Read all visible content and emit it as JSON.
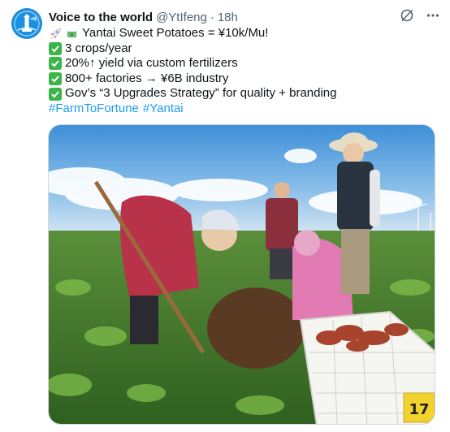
{
  "author": {
    "name": "Voice to the world",
    "handle": "@YtIfeng",
    "separator": "·",
    "time": "18h"
  },
  "icons": {
    "avatar": "lighthouse-logo-icon",
    "grok": "grok-slash-circle-icon",
    "more": "more-dots-icon",
    "rocket": "rocket-emoji-icon",
    "money": "money-with-wings-emoji-icon",
    "check": "check-mark-button-emoji-icon"
  },
  "tweet": {
    "headline": "Yantai Sweet Potatoes = ¥10k/Mu!",
    "points": [
      "3 crops/year",
      "20%↑ yield via custom fertilizers",
      "800+ factories → ¥6B industry",
      "Gov’s “3 Upgrades Strategy” for quality + branding"
    ],
    "hashtags": [
      "#FarmToFortune",
      "#Yantai"
    ]
  },
  "photo": {
    "crate_label": "17"
  },
  "colors": {
    "accent": "#1d9bf0",
    "avatar_bg": "#1d8fe0",
    "check_green": "#3bb54a",
    "secondary_text": "#536471"
  }
}
